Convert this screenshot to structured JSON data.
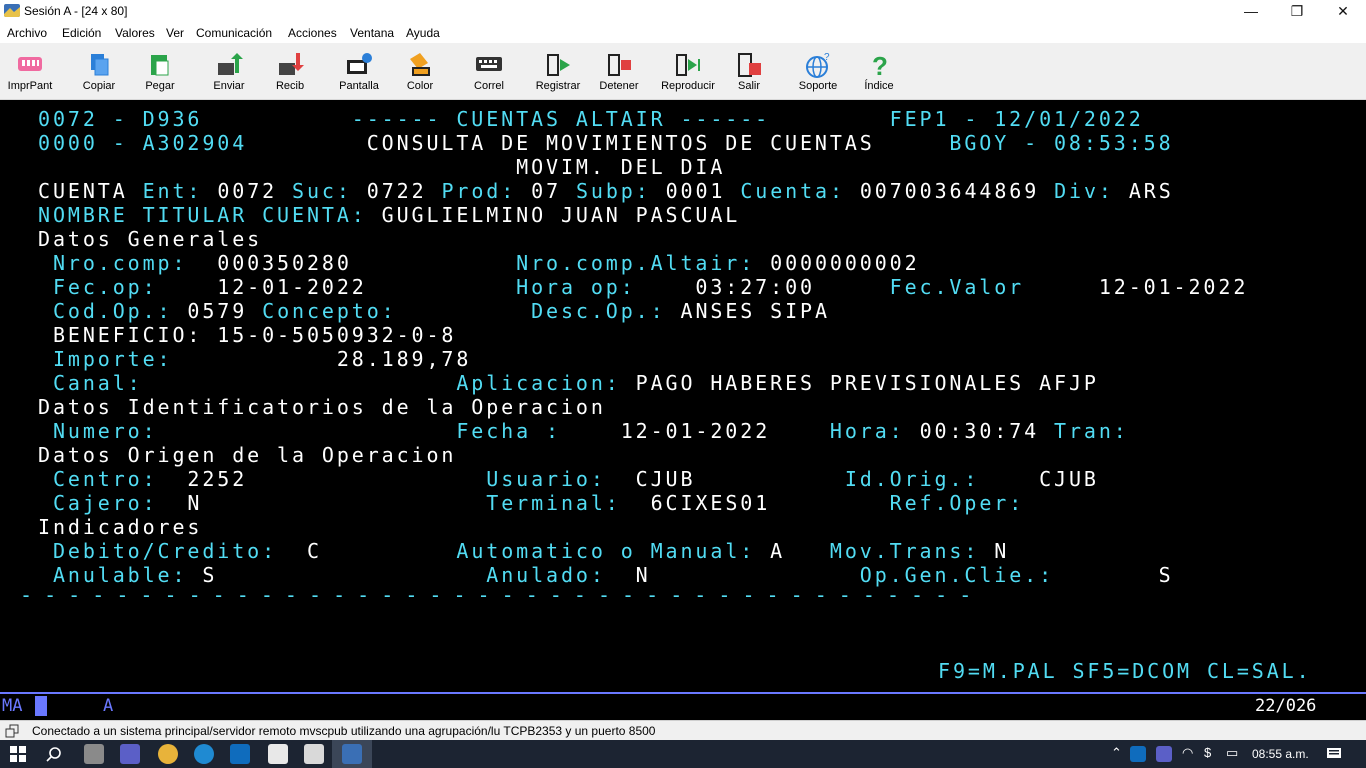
{
  "window": {
    "title": "Sesión A - [24 x 80]",
    "minimize": "—",
    "maximize": "❐",
    "close": "✕"
  },
  "menu": [
    "Archivo",
    "Edición",
    "Valores",
    "Ver",
    "Comunicación",
    "Acciones",
    "Ventana",
    "Ayuda"
  ],
  "toolbar": {
    "items": [
      {
        "label": "ImprPant",
        "icon": "print-screen-icon",
        "color": "#f06aa0"
      },
      {
        "label": "Copiar",
        "icon": "copy-icon",
        "color": "#2b7fd8"
      },
      {
        "label": "Pegar",
        "icon": "paste-icon",
        "color": "#2ba44a"
      },
      {
        "label": "Enviar",
        "icon": "send-file-icon",
        "color": "#2ba44a"
      },
      {
        "label": "Recib",
        "icon": "receive-file-icon",
        "color": "#e04040"
      },
      {
        "label": "Pantalla",
        "icon": "screen-settings-icon",
        "color": "#2b7fd8"
      },
      {
        "label": "Color",
        "icon": "color-bucket-icon",
        "color": "#f0a020"
      },
      {
        "label": "Correl",
        "icon": "keyboard-icon",
        "color": "#333333"
      },
      {
        "label": "Registrar",
        "icon": "record-macro-icon",
        "color": "#2ba44a"
      },
      {
        "label": "Detener",
        "icon": "stop-macro-icon",
        "color": "#e04040"
      },
      {
        "label": "Reproducir",
        "icon": "play-macro-icon",
        "color": "#2ba44a"
      },
      {
        "label": "Salir",
        "icon": "exit-icon",
        "color": "#e04040"
      },
      {
        "label": "Soporte",
        "icon": "support-globe-icon",
        "color": "#2b7fd8"
      },
      {
        "label": "Índice",
        "icon": "help-index-icon",
        "color": "#2ba44a"
      }
    ]
  },
  "terminal": {
    "lines": [
      [
        {
          "t": "0072 - D936          ",
          "c": "cy"
        },
        {
          "t": "------ CUENTAS ALTAIR ------",
          "c": "cy"
        },
        {
          "t": "        FEP1 - 12/01/2022",
          "c": "cy"
        }
      ],
      [
        {
          "t": "0000 - A302904        ",
          "c": "cy"
        },
        {
          "t": "CONSULTA DE MOVIMIENTOS DE CUENTAS",
          "c": "wh"
        },
        {
          "t": "     BGOY - 08:53:58",
          "c": "cy"
        }
      ],
      [
        {
          "t": "                                ",
          "c": "wh"
        },
        {
          "t": "MOVIM. DEL DIA",
          "c": "wh"
        }
      ],
      [
        {
          "t": "CUENTA ",
          "c": "wh"
        },
        {
          "t": "Ent: ",
          "c": "cy"
        },
        {
          "t": "0072 ",
          "c": "wh"
        },
        {
          "t": "Suc: ",
          "c": "cy"
        },
        {
          "t": "0722 ",
          "c": "wh"
        },
        {
          "t": "Prod: ",
          "c": "cy"
        },
        {
          "t": "07 ",
          "c": "wh"
        },
        {
          "t": "Subp: ",
          "c": "cy"
        },
        {
          "t": "0001 ",
          "c": "wh"
        },
        {
          "t": "Cuenta: ",
          "c": "cy"
        },
        {
          "t": "007003644869 ",
          "c": "wh"
        },
        {
          "t": "Div: ",
          "c": "cy"
        },
        {
          "t": "ARS",
          "c": "wh"
        }
      ],
      [
        {
          "t": "NOMBRE TITULAR CUENTA: ",
          "c": "cy"
        },
        {
          "t": "GUGLIELMINO JUAN PASCUAL",
          "c": "wh"
        }
      ],
      [
        {
          "t": "Datos Generales",
          "c": "wh"
        }
      ],
      [
        {
          "t": " Nro.comp:  ",
          "c": "cy"
        },
        {
          "t": "000350280           ",
          "c": "wh"
        },
        {
          "t": "Nro.comp.Altair: ",
          "c": "cy"
        },
        {
          "t": "0000000002",
          "c": "wh"
        }
      ],
      [
        {
          "t": " Fec.op:    ",
          "c": "cy"
        },
        {
          "t": "12-01-2022          ",
          "c": "wh"
        },
        {
          "t": "Hora op:    ",
          "c": "cy"
        },
        {
          "t": "03:27:00     ",
          "c": "wh"
        },
        {
          "t": "Fec.Valor     ",
          "c": "cy"
        },
        {
          "t": "12-01-2022",
          "c": "wh"
        }
      ],
      [
        {
          "t": " Cod.Op.: ",
          "c": "cy"
        },
        {
          "t": "0579 ",
          "c": "wh"
        },
        {
          "t": "Concepto:         ",
          "c": "cy"
        },
        {
          "t": "Desc.Op.: ",
          "c": "cy"
        },
        {
          "t": "ANSES SIPA",
          "c": "wh"
        }
      ],
      [
        {
          "t": " BENEFICIO: 15-0-5050932-0-8",
          "c": "wh"
        }
      ],
      [
        {
          "t": " Importe:           ",
          "c": "cy"
        },
        {
          "t": "28.189,78",
          "c": "wh"
        }
      ],
      [
        {
          "t": " Canal:                     ",
          "c": "cy"
        },
        {
          "t": "Aplicacion: ",
          "c": "cy"
        },
        {
          "t": "PAGO HABERES PREVISIONALES AFJP",
          "c": "wh"
        }
      ],
      [
        {
          "t": "Datos Identificatorios de la Operacion",
          "c": "wh"
        }
      ],
      [
        {
          "t": " Numero:                    ",
          "c": "cy"
        },
        {
          "t": "Fecha :    ",
          "c": "cy"
        },
        {
          "t": "12-01-2022    ",
          "c": "wh"
        },
        {
          "t": "Hora: ",
          "c": "cy"
        },
        {
          "t": "00:30:74 ",
          "c": "wh"
        },
        {
          "t": "Tran:",
          "c": "cy"
        }
      ],
      [
        {
          "t": "Datos Origen de la Operacion",
          "c": "wh"
        }
      ],
      [
        {
          "t": " Centro:  ",
          "c": "cy"
        },
        {
          "t": "2252                ",
          "c": "wh"
        },
        {
          "t": "Usuario:  ",
          "c": "cy"
        },
        {
          "t": "CJUB          ",
          "c": "wh"
        },
        {
          "t": "Id.Orig.:    ",
          "c": "cy"
        },
        {
          "t": "CJUB",
          "c": "wh"
        }
      ],
      [
        {
          "t": " Cajero:  ",
          "c": "cy"
        },
        {
          "t": "N                   ",
          "c": "wh"
        },
        {
          "t": "Terminal:  ",
          "c": "cy"
        },
        {
          "t": "6CIXES01        ",
          "c": "wh"
        },
        {
          "t": "Ref.Oper:",
          "c": "cy"
        }
      ],
      [
        {
          "t": "Indicadores",
          "c": "wh"
        }
      ],
      [
        {
          "t": " Debito/Credito:  ",
          "c": "cy"
        },
        {
          "t": "C         ",
          "c": "wh"
        },
        {
          "t": "Automatico o Manual: ",
          "c": "cy"
        },
        {
          "t": "A   ",
          "c": "wh"
        },
        {
          "t": "Mov.Trans: ",
          "c": "cy"
        },
        {
          "t": "N",
          "c": "wh"
        }
      ],
      [
        {
          "t": " Anulable: ",
          "c": "cy"
        },
        {
          "t": "S                  ",
          "c": "wh"
        },
        {
          "t": "Anulado:  ",
          "c": "cy"
        },
        {
          "t": "N              ",
          "c": "wh"
        },
        {
          "t": "Op.Gen.Clie.:       ",
          "c": "cy"
        },
        {
          "t": "S",
          "c": "wh"
        }
      ]
    ],
    "separator": "- - - - - - - - - - - - - - - - - - - - - - - - - - - - - - - - - - - - - - - -",
    "fkeys": "F9=M.PAL SF5=DCOM CL=SAL."
  },
  "oia": {
    "left": "MA",
    "mid": "A",
    "cursor_pos": "22/026"
  },
  "status_text": "Conectado a un sistema principal/servidor remoto mvscpub utilizando una agrupación/lu TCPB2353 y un puerto 8500",
  "taskbar": {
    "time": "08:55 a.m."
  }
}
